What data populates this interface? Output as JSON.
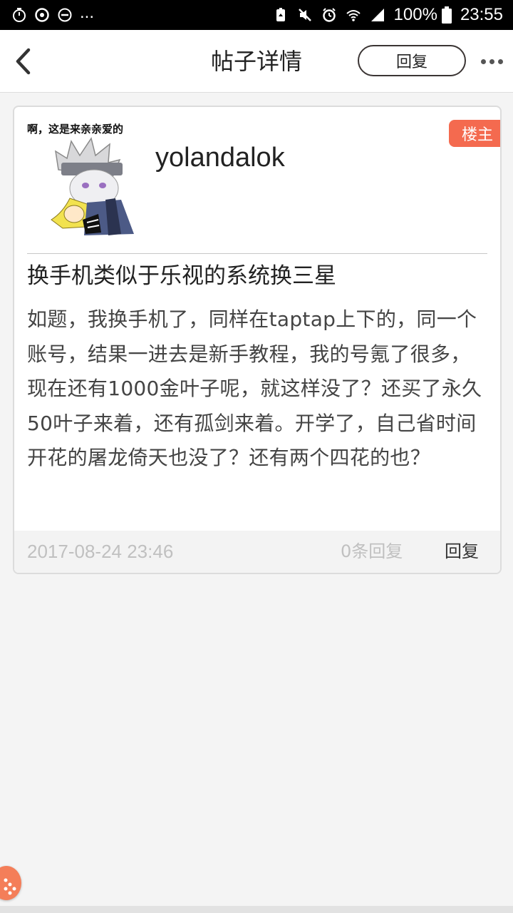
{
  "status_bar": {
    "left_icons": [
      "timer-icon",
      "sync-icon",
      "do-not-disturb-icon"
    ],
    "overflow": "...",
    "right_icons": [
      "battery-saver-icon",
      "mute-icon",
      "alarm-icon",
      "wifi-icon",
      "signal-icon"
    ],
    "battery": "100%",
    "time": "23:55"
  },
  "header": {
    "title": "帖子详情",
    "reply_label": "回复",
    "back_icon": "chevron-left-icon",
    "more_icon": "more-dots-icon"
  },
  "post": {
    "avatar_caption": "啊，这是来亲亲爱的",
    "username": "yolandalok",
    "owner_badge": "楼主",
    "title": "换手机类似于乐视的系统换三星",
    "body": "如题，我换手机了，同样在taptap上下的，同一个账号，结果一进去是新手教程，我的号氪了很多，现在还有1000金叶子呢，就这样没了？还买了永久50叶子来着，还有孤剑来着。开学了，自己省时间开花的屠龙倚天也没了？还有两个四花的也？",
    "time": "2017-08-24 23:46",
    "reply_count": "0条回复",
    "reply_label": "回复"
  },
  "colors": {
    "badge": "#f46a4f",
    "float_button": "#f47e59",
    "muted_text": "#c0c0c0"
  }
}
